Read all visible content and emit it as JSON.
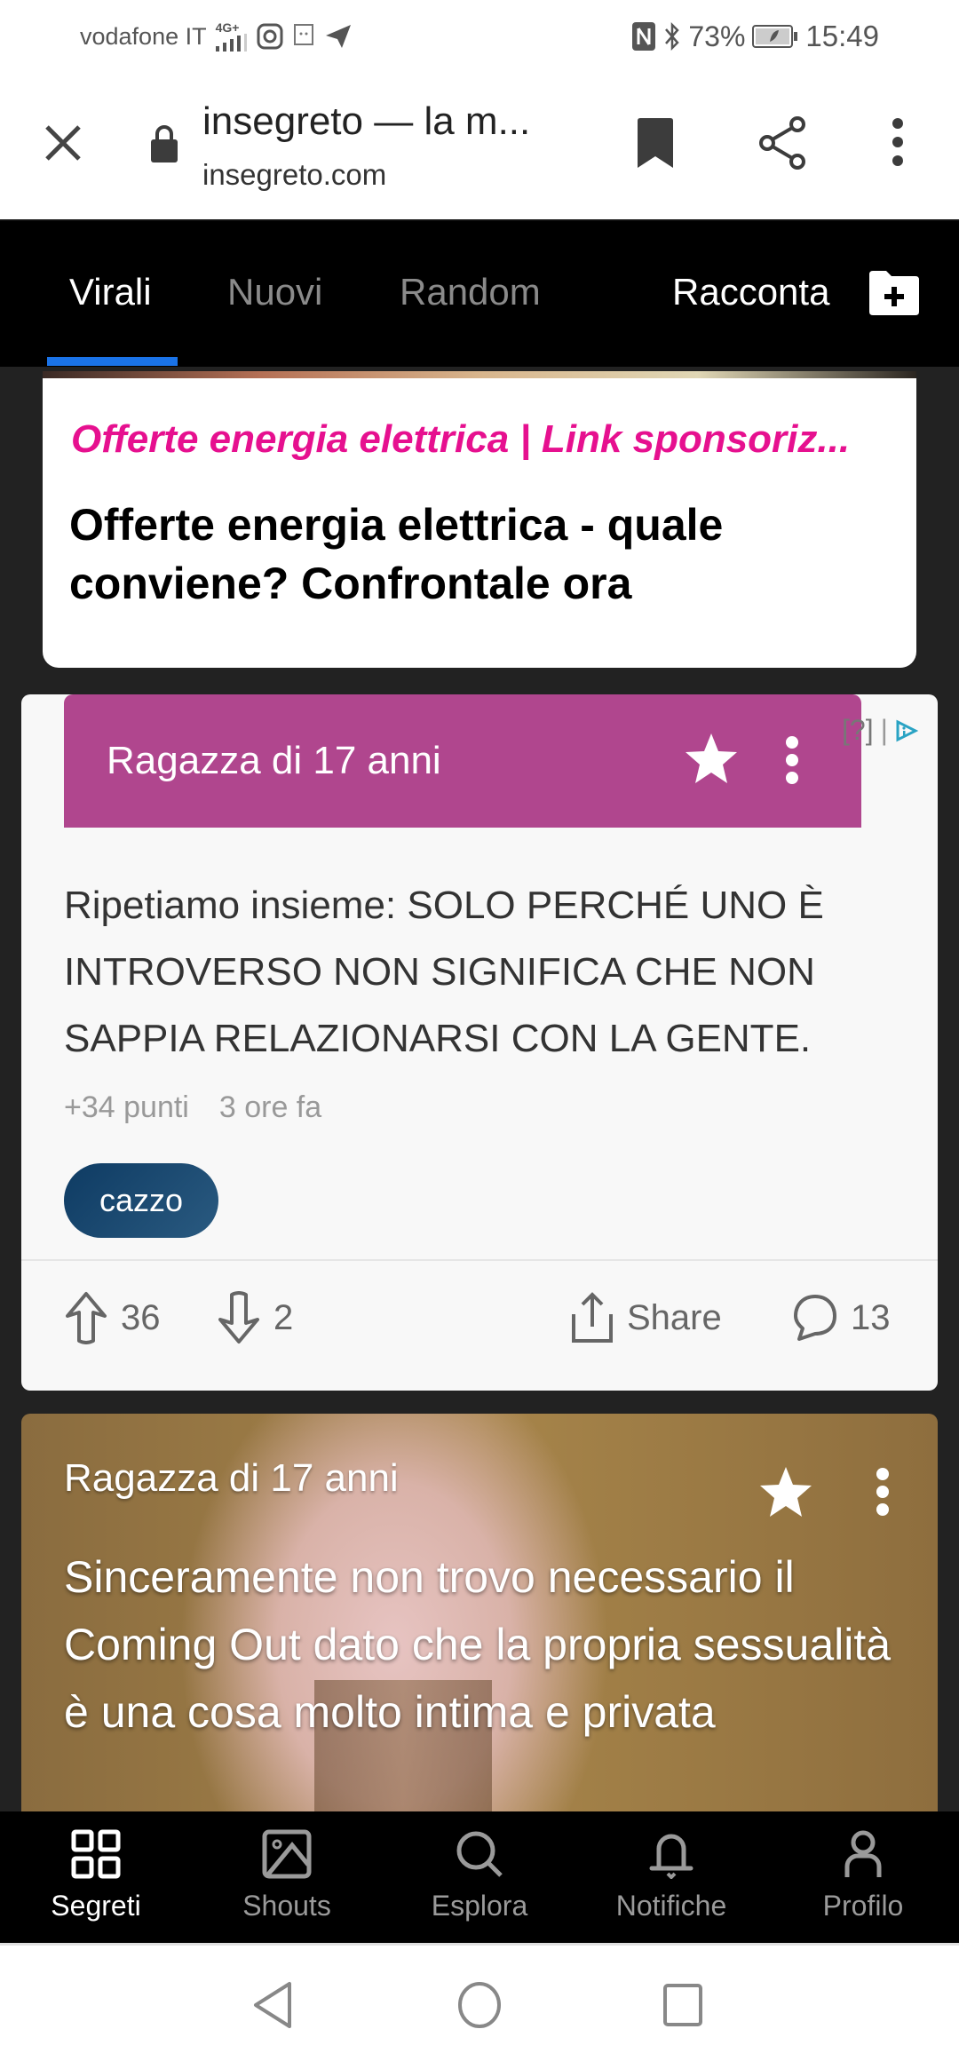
{
  "status_bar": {
    "carrier": "vodafone IT",
    "network": "4G+",
    "battery": "73%",
    "time": "15:49"
  },
  "browser": {
    "page_title": "insegreto — la m...",
    "domain": "insegreto.com",
    "icons": [
      "close-icon",
      "lock-icon",
      "bookmark-icon",
      "share-icon",
      "more-vert-icon"
    ]
  },
  "tabs": {
    "items": [
      {
        "label": "Virali",
        "active": true
      },
      {
        "label": "Nuovi",
        "active": false
      },
      {
        "label": "Random",
        "active": false
      }
    ],
    "racconta_label": "Racconta"
  },
  "ad": {
    "source": "Offerte energia elettrica | Link sponsoriz...",
    "headline": "Offerte energia elettrica - quale conviene? Confrontale ora",
    "adchoice_label": "[?]"
  },
  "posts": [
    {
      "author": "Ragazza di 17 anni",
      "text": "Ripetiamo insieme: SOLO PERCHÉ UNO È INTROVERSO NON SIGNIFICA CHE NON SAPPIA RELAZIONARSI CON LA GENTE.",
      "points": "+34 punti",
      "time": "3 ore fa",
      "tag": "cazzo",
      "upvotes": "36",
      "downvotes": "2",
      "share_label": "Share",
      "comments": "13",
      "header_color": "#b0468e"
    },
    {
      "author": "Ragazza di 17 anni",
      "text": "Sinceramente non trovo necessario il Coming Out dato che la propria sessualità è una cosa molto intima e privata"
    }
  ],
  "bottom_nav": {
    "items": [
      {
        "label": "Segreti",
        "icon": "grid-icon",
        "active": true
      },
      {
        "label": "Shouts",
        "icon": "image-icon",
        "active": false
      },
      {
        "label": "Esplora",
        "icon": "search-icon",
        "active": false
      },
      {
        "label": "Notifiche",
        "icon": "bell-icon",
        "active": false
      },
      {
        "label": "Profilo",
        "icon": "person-icon",
        "active": false
      }
    ]
  },
  "colors": {
    "accent_tab": "#1a73e8",
    "ad_source": "#e6108f",
    "post_header": "#b0468e",
    "tag": "#0e3b63"
  }
}
